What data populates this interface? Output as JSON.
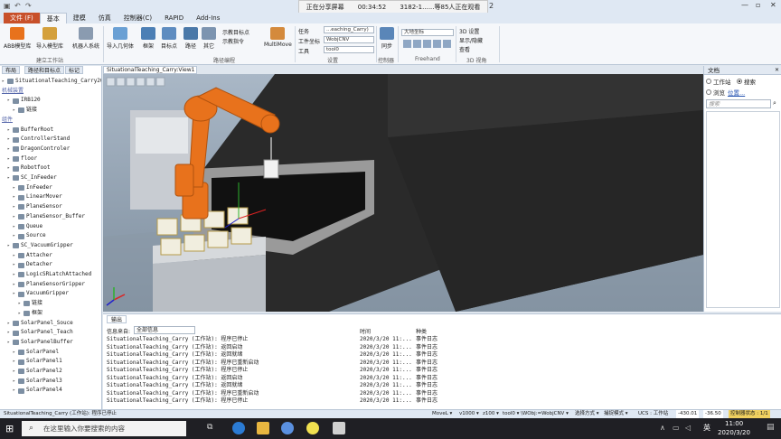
{
  "share": {
    "label": "正在分享屏幕",
    "time": "00:34:52",
    "viewers": "3182-1......等85人正在观看"
  },
  "app_title_suffix": "2",
  "tabs": [
    "文件 (F)",
    "基本",
    "建模",
    "仿真",
    "控制器(C)",
    "RAPID",
    "Add-Ins"
  ],
  "ribbon": {
    "group1_buttons": [
      "ABB模型库",
      "导入模型库",
      "机器人系统"
    ],
    "group1_label": "建立工作站",
    "group2_buttons": [
      "导入几何体",
      "框架",
      "目标点",
      "路径",
      "其它"
    ],
    "teach_items": [
      "示教目标点",
      "示教指令"
    ],
    "multimove": "MultiMove",
    "group2_label": "路径编程",
    "settings_labels": [
      "任务",
      "工件坐标",
      "工具"
    ],
    "settings_values": [
      "...eaching_Carry)",
      "WobjCNV",
      "tool0"
    ],
    "group3_label": "设置",
    "sync": "同步",
    "group4_label": "控制器",
    "freehand_combo": "大地坐标",
    "group5_label": "Freehand",
    "view3d_items": [
      "3D 设置",
      "显示/隐藏",
      "查看"
    ],
    "group6_label": "3D 视角"
  },
  "left_panel": {
    "tabs": [
      "布局",
      "路径和目标点",
      "标记"
    ],
    "tree": [
      {
        "label": "SituationalTeaching_Carry20",
        "indent": 0,
        "type": "root"
      },
      {
        "label": "机械装置",
        "indent": 0,
        "type": "header"
      },
      {
        "label": "IRB120",
        "indent": 1,
        "type": "item"
      },
      {
        "label": "链接",
        "indent": 2,
        "type": "item"
      },
      {
        "label": "组件",
        "indent": 0,
        "type": "header"
      },
      {
        "label": "BufferRoot",
        "indent": 1,
        "type": "item"
      },
      {
        "label": "ControllerStand",
        "indent": 1,
        "type": "item"
      },
      {
        "label": "DragonControler",
        "indent": 1,
        "type": "item"
      },
      {
        "label": "floor",
        "indent": 1,
        "type": "item"
      },
      {
        "label": "Robotfoot",
        "indent": 1,
        "type": "item"
      },
      {
        "label": "SC_InFeeder",
        "indent": 1,
        "type": "item"
      },
      {
        "label": "InFeeder",
        "indent": 2,
        "type": "item"
      },
      {
        "label": "LinearMover",
        "indent": 2,
        "type": "item"
      },
      {
        "label": "PlaneSensor",
        "indent": 2,
        "type": "item"
      },
      {
        "label": "PlaneSensor_Buffer",
        "indent": 2,
        "type": "item"
      },
      {
        "label": "Queue",
        "indent": 2,
        "type": "item"
      },
      {
        "label": "Source",
        "indent": 2,
        "type": "item"
      },
      {
        "label": "SC_VacuumGripper",
        "indent": 1,
        "type": "item"
      },
      {
        "label": "Attacher",
        "indent": 2,
        "type": "item"
      },
      {
        "label": "Detacher",
        "indent": 2,
        "type": "item"
      },
      {
        "label": "LogicSRLatchAttached",
        "indent": 2,
        "type": "item"
      },
      {
        "label": "PlaneSensorGripper",
        "indent": 2,
        "type": "item"
      },
      {
        "label": "VacuumGripper",
        "indent": 2,
        "type": "item"
      },
      {
        "label": "链接",
        "indent": 3,
        "type": "item"
      },
      {
        "label": "框架",
        "indent": 3,
        "type": "item"
      },
      {
        "label": "SolarPanel_Souce",
        "indent": 1,
        "type": "item"
      },
      {
        "label": "SolarPanel_Teach",
        "indent": 1,
        "type": "item"
      },
      {
        "label": "SolarPanelBuffer",
        "indent": 1,
        "type": "item"
      },
      {
        "label": "SolarPanel",
        "indent": 2,
        "type": "item"
      },
      {
        "label": "SolarPanel1",
        "indent": 2,
        "type": "item"
      },
      {
        "label": "SolarPanel2",
        "indent": 2,
        "type": "item"
      },
      {
        "label": "SolarPanel3",
        "indent": 2,
        "type": "item"
      },
      {
        "label": "SolarPanel4",
        "indent": 2,
        "type": "item"
      }
    ]
  },
  "view_tab": "SituationalTeaching_Carry:View1",
  "right_panel": {
    "title": "文档",
    "radio_workstation": "工作站",
    "radio_search": "搜索",
    "browse": "浏览",
    "position_link": "位置...",
    "search_placeholder": "搜索"
  },
  "output": {
    "tab": "输出",
    "filter_label": "信息来自:",
    "filter_value": "全部信息",
    "col_time": "时间",
    "col_type": "种类",
    "rows": [
      {
        "msg": "SituationalTeaching_Carry (工作站): 程序已停止",
        "time": "2020/3/20 11:...",
        "type": "事件日志"
      },
      {
        "msg": "SituationalTeaching_Carry (工作站): 返回启动",
        "time": "2020/3/20 11:...",
        "type": "事件日志"
      },
      {
        "msg": "SituationalTeaching_Carry (工作站): 返回就绪",
        "time": "2020/3/20 11:...",
        "type": "事件日志"
      },
      {
        "msg": "SituationalTeaching_Carry (工作站): 程序已重新启动",
        "time": "2020/3/20 11:...",
        "type": "事件日志"
      },
      {
        "msg": "SituationalTeaching_Carry (工作站): 程序已停止",
        "time": "2020/3/20 11:...",
        "type": "事件日志"
      },
      {
        "msg": "SituationalTeaching_Carry (工作站): 返回启动",
        "time": "2020/3/20 11:...",
        "type": "事件日志"
      },
      {
        "msg": "SituationalTeaching_Carry (工作站): 返回就绪",
        "time": "2020/3/20 11:...",
        "type": "事件日志"
      },
      {
        "msg": "SituationalTeaching_Carry (工作站): 程序已重新启动",
        "time": "2020/3/20 11:...",
        "type": "事件日志"
      },
      {
        "msg": "SituationalTeaching_Carry (工作站): 程序已停止",
        "time": "2020/3/20 11:...",
        "type": "事件日志"
      }
    ]
  },
  "status": {
    "left": "SituationalTeaching_Carry (工作站): 程序已停止",
    "movel": "MoveL ▾",
    "speed": "v1000 ▾",
    "zone": "z100 ▾",
    "tool": "tool0 ▾",
    "wobj": "\\WObj:=WobjCNV ▾",
    "select_mode": "选择方式 ▾",
    "snap_mode": "捕捉模式 ▾",
    "ucs": "UCS : 工作站",
    "x": "-430.01",
    "y": "-36.50",
    "ctrl_state": "控制器状态 : 1/1"
  },
  "taskbar": {
    "search_placeholder": "在这里输入你要搜索的内容",
    "time": "11:00",
    "date": "2020/3/20",
    "lang": "英"
  },
  "colors": {
    "accent_file": "#c8502a",
    "robot_orange": "#e8721c",
    "taskbar": "#1f1f24"
  }
}
